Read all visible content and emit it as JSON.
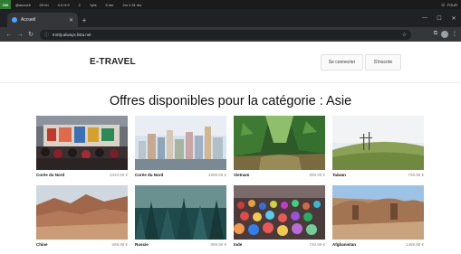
{
  "statusbar": {
    "workspace": "106",
    "items": [
      "@accueil",
      "20+m",
      "4.0 H:9",
      "2",
      "+pts",
      "5 mn",
      "2m 1.31 ms"
    ],
    "right_label": "FOUR"
  },
  "browser": {
    "tab_title": "Accueil",
    "url": "trottly.always.lista.net"
  },
  "site": {
    "logo": "E-TRAVEL",
    "login_label": "Se connecter",
    "signup_label": "S'inscrire"
  },
  "heading": "Offres disponibles pour la catégorie : Asie",
  "offers": [
    {
      "country": "Corée du Nord",
      "price": "3333.99 €"
    },
    {
      "country": "Corée du Nord",
      "price": "4999.99 €"
    },
    {
      "country": "Vietnam",
      "price": "999.99 €"
    },
    {
      "country": "Taiwan",
      "price": "799.99 €"
    },
    {
      "country": "Chine",
      "price": "599.99 €"
    },
    {
      "country": "Russie",
      "price": "899.99 €"
    },
    {
      "country": "Inde",
      "price": "749.99 €"
    },
    {
      "country": "Afghanistan",
      "price": "1499.99 €"
    }
  ]
}
